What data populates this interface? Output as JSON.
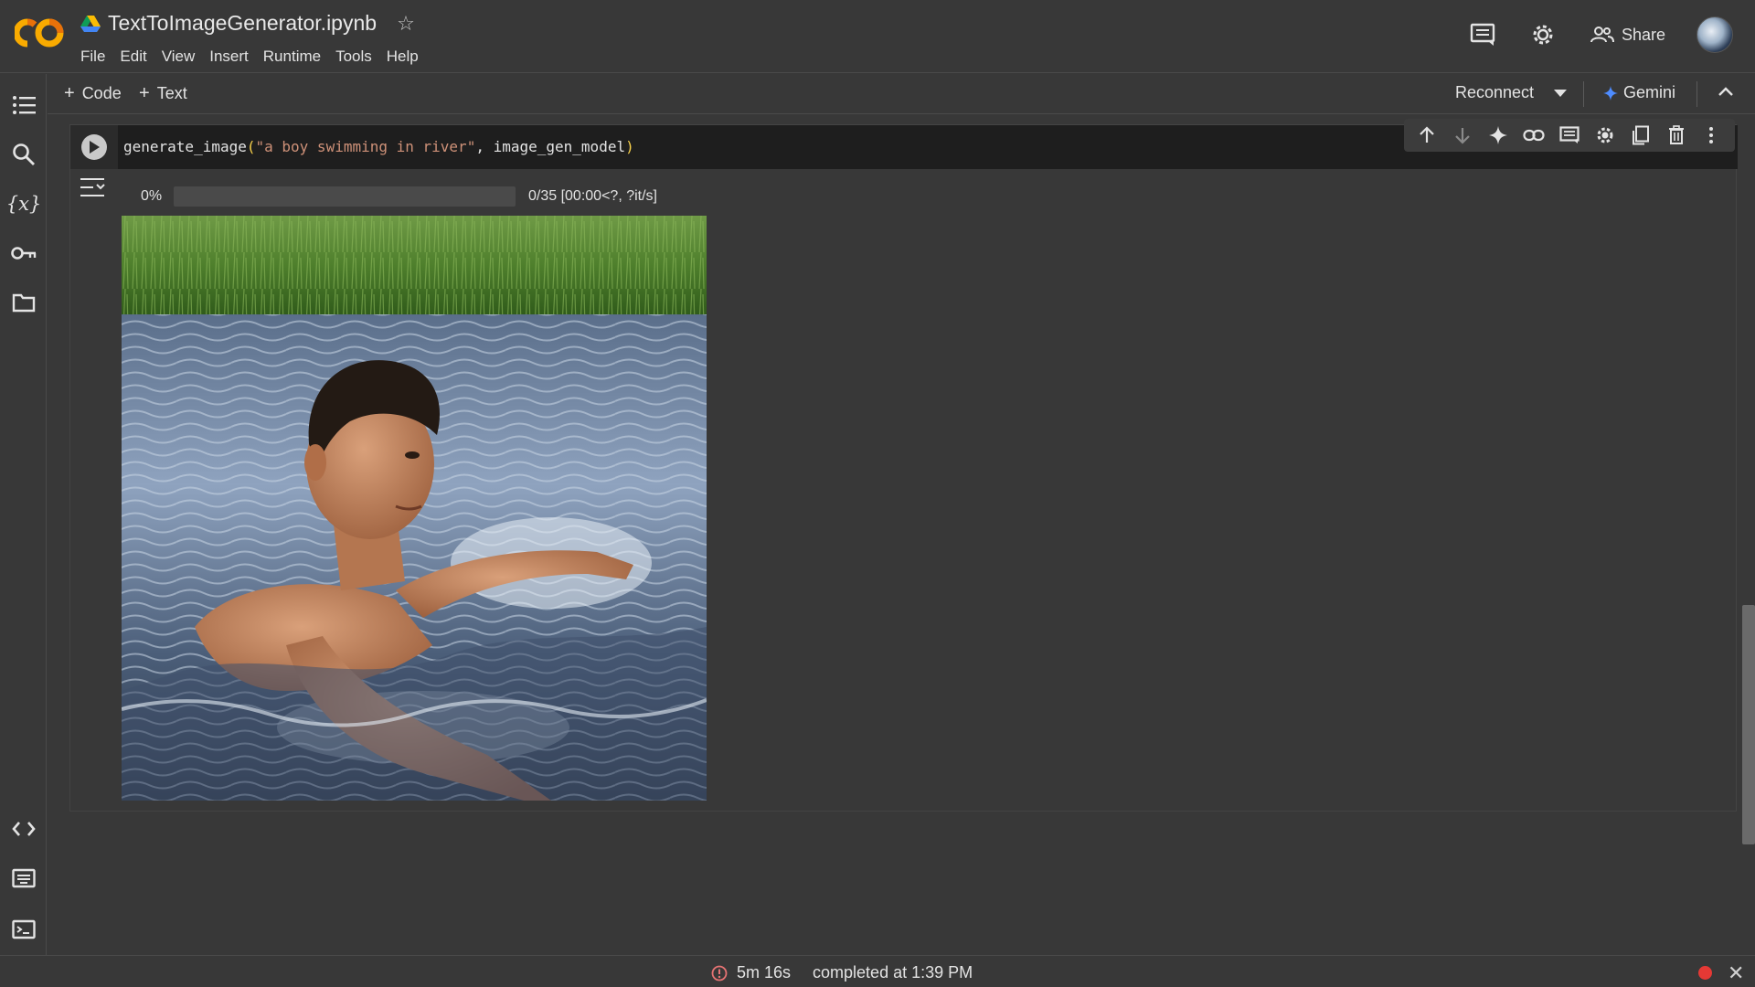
{
  "header": {
    "doc_title": "TextToImageGenerator.ipynb",
    "menu": [
      "File",
      "Edit",
      "View",
      "Insert",
      "Runtime",
      "Tools",
      "Help"
    ],
    "share_label": "Share"
  },
  "toolbar": {
    "add_code_label": "Code",
    "add_text_label": "Text",
    "reconnect_label": "Reconnect",
    "gemini_label": "Gemini"
  },
  "sidebar": {
    "top_icons": [
      "table-of-contents-icon",
      "search-icon",
      "variables-icon",
      "secrets-key-icon",
      "folder-icon"
    ],
    "bottom_icons": [
      "code-snippets-icon",
      "command-palette-icon",
      "terminal-icon"
    ]
  },
  "cell": {
    "code": {
      "fn": "generate_image",
      "open": "(",
      "str": "\"a boy swimming in river\"",
      "sep": ", ",
      "arg": "image_gen_model",
      "close": ")"
    },
    "toolbar_icons": [
      "arrow-up-icon",
      "arrow-down-icon",
      "gemini-sparkle-icon",
      "link-icon",
      "comment-icon",
      "settings-icon",
      "mirror-cell-icon",
      "delete-icon",
      "more-vert-icon"
    ],
    "progress": {
      "percent_label": "0%",
      "fraction": 0,
      "stats": "0/35  [00:00<?,  ?it/s]"
    },
    "image_subject": "boy swimming in a river with grassy bank"
  },
  "status": {
    "elapsed": "5m 16s",
    "completed": "completed at 1:39 PM"
  },
  "colors": {
    "background": "#383838",
    "code_background": "#1e1e1e",
    "accent_orange": "#f9ab00",
    "status_red": "#e53935",
    "gemini_blue": "#4e8cff"
  }
}
